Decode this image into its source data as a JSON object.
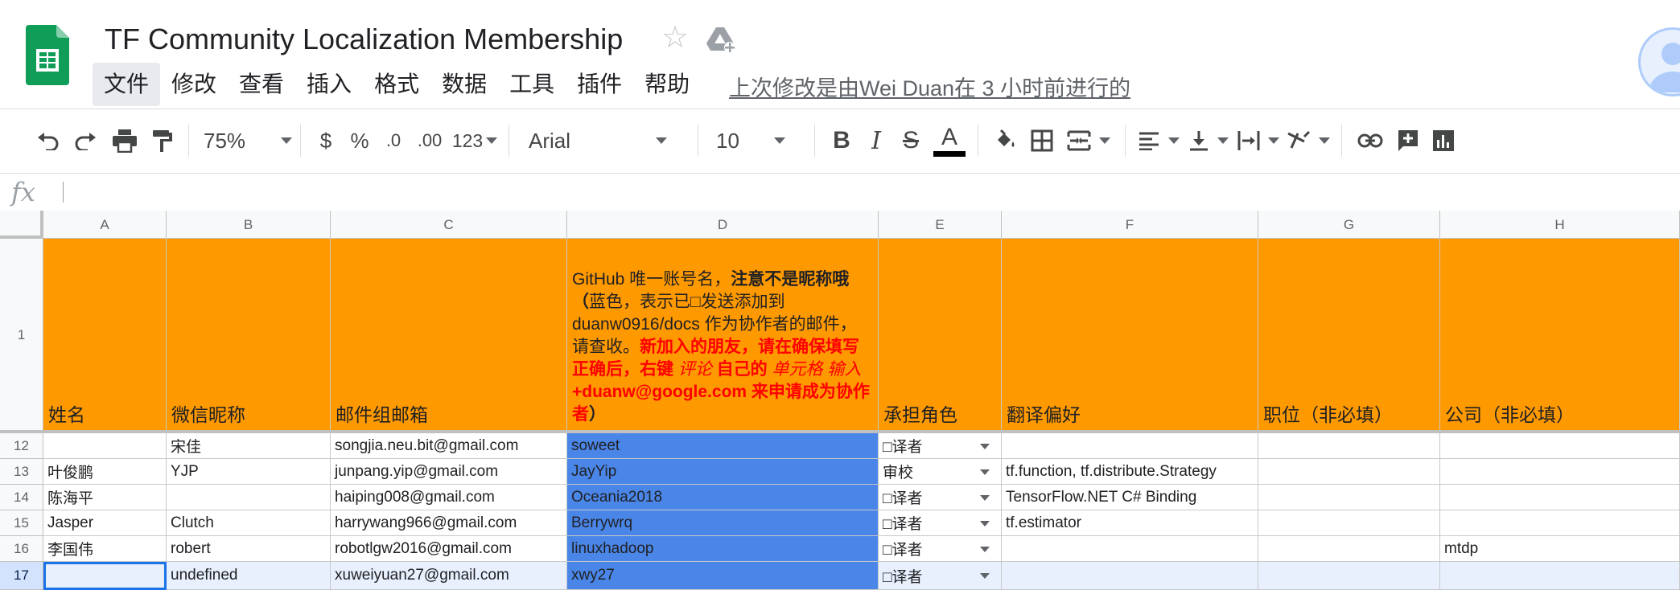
{
  "doc": {
    "title": "TF Community Localization Membership",
    "last_edit": "上次修改是由Wei Duan在 3 小时前进行的"
  },
  "menu": [
    "文件",
    "修改",
    "查看",
    "插入",
    "格式",
    "数据",
    "工具",
    "插件",
    "帮助"
  ],
  "toolbar": {
    "zoom": "75%",
    "currency": "$",
    "percent": "%",
    "decrease_decimal": ".0",
    "increase_decimal": ".00",
    "number_format": "123",
    "font": "Arial",
    "font_size": "10",
    "bold": "B",
    "italic": "I",
    "strikethrough": "S",
    "text_color": "A"
  },
  "formula_bar": {
    "label": "fx",
    "value": ""
  },
  "columns": [
    "A",
    "B",
    "C",
    "D",
    "E",
    "F",
    "G",
    "H"
  ],
  "header_row": {
    "row_num": "1",
    "a": "姓名",
    "b": "微信昵称",
    "c": "邮件组邮箱",
    "d_part1": "GitHub 唯一账号名，",
    "d_part2_bold": "注意不是昵称哦（",
    "d_part3": "蓝色，表示已□发送添加到 duanw0916/docs 作为协作者的邮件，请查收。",
    "d_part4_red": "新加入的朋友，请在确保填写正确后，右键 ",
    "d_part5_red_italic": "评论",
    "d_part6_red": " 自己的 ",
    "d_part7_red_italic": "单元格",
    "d_part8_red_italic": " 输入",
    "d_part9_red": " +duanw@google.com 来申请成为协作者",
    "d_part10_bold": "）",
    "e": "承担角色",
    "f": "翻译偏好",
    "g": "职位（非必填）",
    "h": "公司（非必填）"
  },
  "rows": [
    {
      "num": "12",
      "a": "",
      "b": "宋佳",
      "c": "songjia.neu.bit@gmail.com",
      "d": "soweet",
      "e": "□译者",
      "f": "",
      "g": "",
      "h": ""
    },
    {
      "num": "13",
      "a": "叶俊鹏",
      "b": "YJP",
      "c": "junpang.yip@gmail.com",
      "d": "JayYip",
      "e": "审校",
      "f": "tf.function, tf.distribute.Strategy",
      "g": "",
      "h": ""
    },
    {
      "num": "14",
      "a": "陈海平",
      "b": "",
      "c": "haiping008@gmail.com",
      "d": "Oceania2018",
      "e": "□译者",
      "f": "TensorFlow.NET C# Binding",
      "g": "",
      "h": ""
    },
    {
      "num": "15",
      "a": "Jasper",
      "b": "Clutch",
      "c": "harrywang966@gmail.com",
      "d": "Berrywrq",
      "e": "□译者",
      "f": "tf.estimator",
      "g": "",
      "h": ""
    },
    {
      "num": "16",
      "a": "李国伟",
      "b": "robert",
      "c": "robotlgw2016@gmail.com",
      "d": "linuxhadoop",
      "e": "□译者",
      "f": "",
      "g": "",
      "h": "mtdp"
    },
    {
      "num": "17",
      "a": "",
      "b": "undefined",
      "c": "xuweiyuan27@gmail.com",
      "d": "xwy27",
      "e": "□译者",
      "f": "",
      "g": "",
      "h": ""
    }
  ],
  "colors": {
    "header_fill": "#ff9900",
    "github_fill": "#4a86e8",
    "selection": "#e8f0fe"
  }
}
